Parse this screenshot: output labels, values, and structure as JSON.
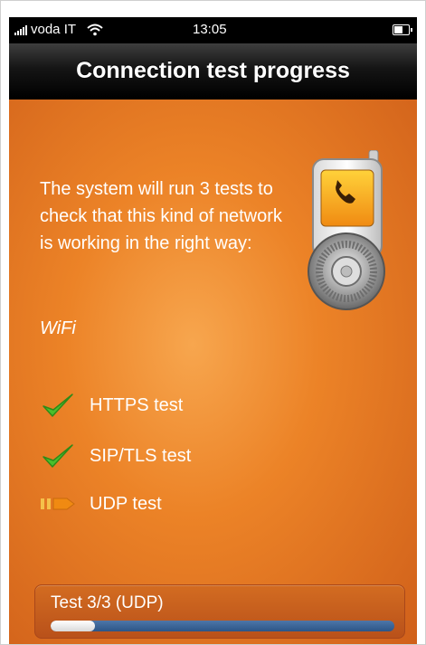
{
  "status_bar": {
    "carrier": "voda IT",
    "time": "13:05"
  },
  "navbar": {
    "title": "Connection test progress"
  },
  "main": {
    "description": "The system will run 3 tests to check that this kind of network is working in the right way:",
    "network_type": "WiFi",
    "tests": [
      {
        "label": "HTTPS test",
        "status": "passed",
        "icon": "check-icon"
      },
      {
        "label": "SIP/TLS test",
        "status": "passed",
        "icon": "check-icon"
      },
      {
        "label": "UDP test",
        "status": "in-progress",
        "icon": "in-progress-arrow-icon"
      }
    ]
  },
  "progress": {
    "label": "Test 3/3 (UDP)",
    "fraction": 0.13
  },
  "colors": {
    "background_orange": "#ec8327",
    "check_green": "#4bbf2c",
    "progress_blue": "#2c5587",
    "arrow_yellow": "#f5c14a"
  }
}
